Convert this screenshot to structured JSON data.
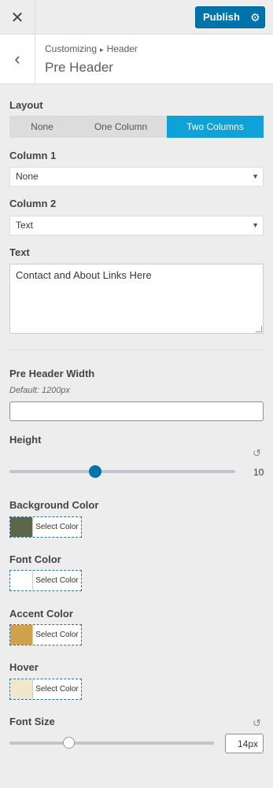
{
  "topbar": {
    "close_symbol": "✕",
    "publish_label": "Publish",
    "gear_symbol": "⚙"
  },
  "section": {
    "back_symbol": "‹",
    "crumb_root": "Customizing",
    "crumb_sep": "▸",
    "crumb_parent": "Header",
    "title": "Pre Header"
  },
  "layout": {
    "label": "Layout",
    "options": [
      "None",
      "One Column",
      "Two Columns"
    ],
    "selected": "Two Columns"
  },
  "column1": {
    "label": "Column 1",
    "value": "None"
  },
  "column2": {
    "label": "Column 2",
    "value": "Text"
  },
  "text": {
    "label": "Text",
    "value": "Contact and About Links Here"
  },
  "width": {
    "label": "Pre Header Width",
    "description": "Default: 1200px",
    "value": ""
  },
  "height": {
    "label": "Height",
    "value": "10",
    "fraction": 0.38
  },
  "colors": [
    {
      "label": "Background Color",
      "button": "Select Color",
      "color": "#5f6549"
    },
    {
      "label": "Font Color",
      "button": "Select Color",
      "color": "#ffffff"
    },
    {
      "label": "Accent Color",
      "button": "Select Color",
      "color": "#d0a24e"
    },
    {
      "label": "Hover",
      "button": "Select Color",
      "color": "#f1e8cc"
    }
  ],
  "font_size": {
    "label": "Font Size",
    "value": "14px",
    "fraction": 0.29
  },
  "icons": {
    "reset": "↺",
    "caret": "▼"
  },
  "accent": "#0073aa"
}
